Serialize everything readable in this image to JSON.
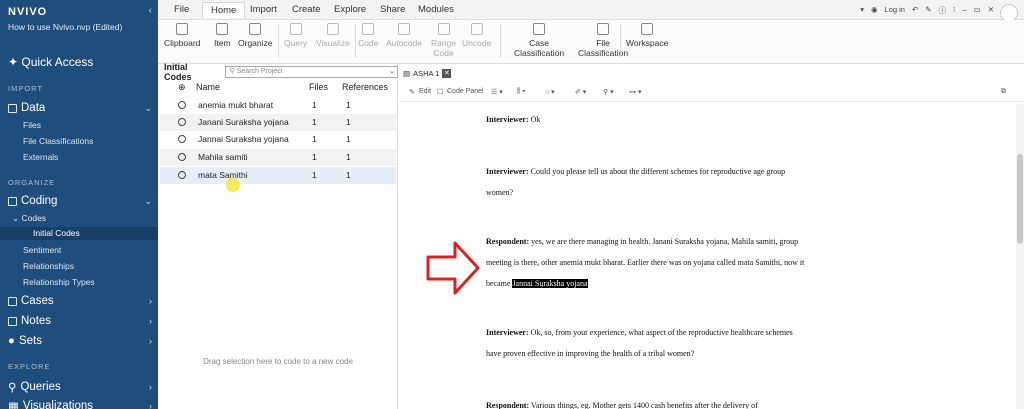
{
  "app": {
    "brand": "NVIVO",
    "project_name": "How to use Nvivo.nvp (Edited)"
  },
  "sidebar": {
    "quick_access": "Quick Access",
    "import_label": "IMPORT",
    "data": "Data",
    "data_items": [
      "Files",
      "File Classifications",
      "Externals"
    ],
    "organize_label": "ORGANIZE",
    "coding": "Coding",
    "codes": "Codes",
    "initial_codes": "Initial Codes",
    "coding_items": [
      "Sentiment",
      "Relationships",
      "Relationship Types"
    ],
    "cases": "Cases",
    "notes": "Notes",
    "sets": "Sets",
    "explore_label": "EXPLORE",
    "queries": "Queries",
    "visualizations": "Visualizations"
  },
  "tabs": [
    "File",
    "Home",
    "Import",
    "Create",
    "Explore",
    "Share",
    "Modules"
  ],
  "active_tab": "Home",
  "topright": {
    "login": "Log in"
  },
  "ribbon": [
    {
      "label": "Clipboard",
      "label2": "",
      "enabled": true
    },
    {
      "label": "Item",
      "label2": "",
      "enabled": true
    },
    {
      "label": "Organize",
      "label2": "",
      "enabled": true
    },
    {
      "label": "Query",
      "label2": "",
      "enabled": false
    },
    {
      "label": "Visualize",
      "label2": "",
      "enabled": false
    },
    {
      "label": "Code",
      "label2": "",
      "enabled": false
    },
    {
      "label": "Autocode",
      "label2": "",
      "enabled": false
    },
    {
      "label": "Range",
      "label2": "Code",
      "enabled": false
    },
    {
      "label": "Uncode",
      "label2": "",
      "enabled": false
    },
    {
      "label": "Case",
      "label2": "Classification",
      "enabled": true
    },
    {
      "label": "File",
      "label2": "Classification",
      "enabled": true
    },
    {
      "label": "Workspace",
      "label2": "",
      "enabled": true
    }
  ],
  "codes_panel": {
    "title": "Initial Codes",
    "search_placeholder": "Search Project",
    "col_name": "Name",
    "col_files": "Files",
    "col_refs": "References",
    "rows": [
      {
        "name": "anemia mukt bharat",
        "files": "1",
        "refs": "1"
      },
      {
        "name": "Janani Suraksha yojana",
        "files": "1",
        "refs": "1"
      },
      {
        "name": "Jannai Suraksha yojana",
        "files": "1",
        "refs": "1"
      },
      {
        "name": "Mahila samiti",
        "files": "1",
        "refs": "1"
      },
      {
        "name": "mata Samithi",
        "files": "1",
        "refs": "1"
      }
    ],
    "drag_hint": "Drag selection here to code to a new code"
  },
  "document": {
    "tab_name": "ASHA 1",
    "tools": {
      "edit": "Edit",
      "code_panel": "Code Panel"
    },
    "p1": {
      "speaker": "Interviewer:",
      "text": " Ok"
    },
    "p2": {
      "speaker": "Interviewer:",
      "text": " Could you please tell us about the different schemes for reproductive age group women?"
    },
    "p3": {
      "speaker": "Respondent:",
      "text": " yes, we are there managing in health. Janani Suraksha yojana, Mahila samiti, group meeting is there, other anemia mukt bharat. Earlier there was on yojana called mata Samithi, now it became ",
      "highlight": "Jannai Suraksha yojana"
    },
    "p4": {
      "speaker": "Interviewer:",
      "text": " Ok, so, from your experience, what aspect of the reproductive healthcare schemes have proven effective in improving the health of a tribal women?"
    },
    "p5": {
      "speaker": "Respondent:",
      "text": " Various things, eg. Mother gets 1400 cash benefits after the delivery of"
    }
  },
  "colors": {
    "sidebar_bg": "#1f4e7d",
    "arrow": "#e02020",
    "highlight": "#000000"
  }
}
